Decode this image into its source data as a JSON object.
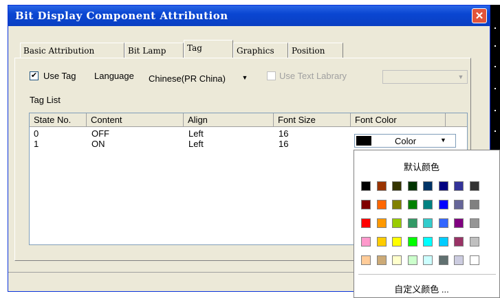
{
  "window": {
    "title": "Bit Display Component Attribution",
    "close": "✕"
  },
  "tabs": [
    {
      "label": "Basic Attribution"
    },
    {
      "label": "Bit Lamp"
    },
    {
      "label": "Tag"
    },
    {
      "label": "Graphics"
    },
    {
      "label": "Position"
    }
  ],
  "form": {
    "use_tag_label": "Use Tag",
    "use_tag_checked": "✔",
    "language_label": "Language",
    "language_value": "Chinese(PR China)",
    "use_text_library_label": "Use Text Labrary",
    "library_value": "",
    "tag_list_label": "Tag List"
  },
  "table": {
    "headers": [
      "State No.",
      "Content",
      "Align",
      "Font Size",
      "Font Color"
    ],
    "rows": [
      {
        "state": "0",
        "content": "OFF",
        "align": "Left",
        "size": "16"
      },
      {
        "state": "1",
        "content": "ON",
        "align": "Left",
        "size": "16"
      }
    ]
  },
  "color_select": {
    "value": "Color",
    "arrow": "▼"
  },
  "color_popup": {
    "default_label": "默认颜色",
    "custom_label": "自定义颜色 ...",
    "swatches": [
      [
        "#000000",
        "#993300",
        "#333300",
        "#003300",
        "#003366",
        "#000080",
        "#333399",
        "#333333"
      ],
      [
        "#800000",
        "#ff6600",
        "#808000",
        "#008000",
        "#008080",
        "#0000ff",
        "#666699",
        "#808080"
      ],
      [
        "#ff0000",
        "#ff9900",
        "#99cc00",
        "#339966",
        "#33cccc",
        "#3366ff",
        "#800080",
        "#969696"
      ],
      [
        "#ff99cc",
        "#ffcc00",
        "#ffff00",
        "#00ff00",
        "#00ffff",
        "#00ccff",
        "#993366",
        "#c0c0c0"
      ],
      [
        "#ffcc99",
        "#ccaa77",
        "#ffffcc",
        "#ccffcc",
        "#ccffff",
        "#607070",
        "#cccce0",
        "#ffffff"
      ]
    ]
  }
}
